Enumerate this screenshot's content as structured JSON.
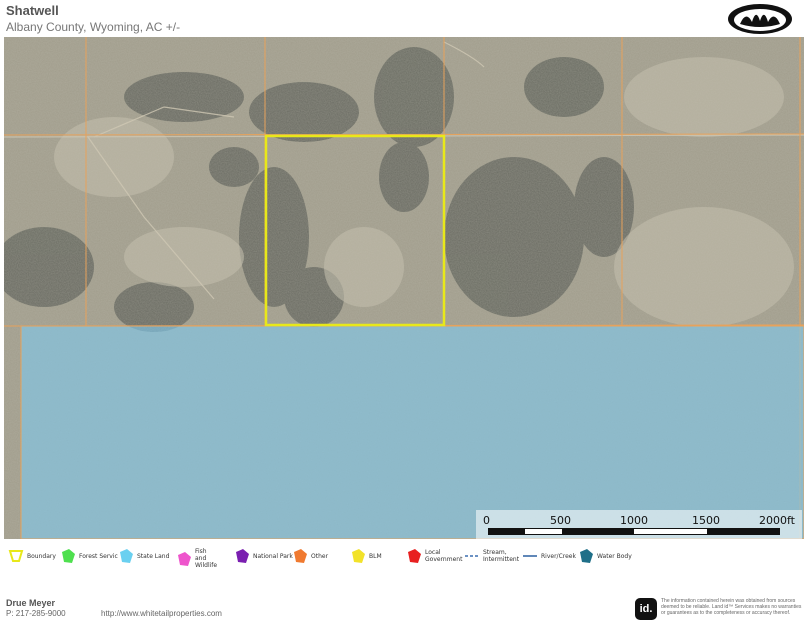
{
  "header": {
    "title": "Shatwell",
    "subtitle": "Albany County, Wyoming,  AC +/-"
  },
  "map": {
    "colors": {
      "parcel_boundary": "#e8e81a",
      "state_land": "#7fc8ec",
      "section_lines": "#e7a25b"
    },
    "scale_bar": {
      "labels": [
        "0",
        "500",
        "1000",
        "1500",
        "2000ft"
      ]
    }
  },
  "legend": {
    "items": [
      {
        "label": "Boundary",
        "color": "#e8e81a",
        "icon": "boundary-icon"
      },
      {
        "label": "Forest Servic",
        "color": "#4fe04f",
        "icon": "forest-service-icon"
      },
      {
        "label": "State Land",
        "color": "#6ad0f0",
        "icon": "state-land-icon"
      },
      {
        "label": "Fish and Wildlife",
        "color": "#ee55cc",
        "icon": "fish-wildlife-icon"
      },
      {
        "label": "National Park",
        "color": "#7a1fb0",
        "icon": "national-park-icon"
      },
      {
        "label": "Other",
        "color": "#f07a30",
        "icon": "other-icon"
      },
      {
        "label": "BLM",
        "color": "#f2e22a",
        "icon": "blm-icon"
      },
      {
        "label": "Local Government",
        "color": "#e82020",
        "icon": "local-government-icon"
      },
      {
        "label": "Stream, Intermittent",
        "color": "#3b6fb0",
        "icon": "stream-icon"
      },
      {
        "label": "River/Creek",
        "color": "#2b5fa0",
        "icon": "river-icon"
      },
      {
        "label": "Water Body",
        "color": "#1f6f88",
        "icon": "water-body-icon"
      }
    ]
  },
  "footer": {
    "agent_name": "Drue Meyer",
    "agent_phone": "P: 217-285-9000",
    "website": "http://www.whitetailproperties.com",
    "id_logo": "id.",
    "disclaimer": "The information contained herein was obtained from sources deemed to be reliable. Land id™ Services makes no warranties or guarantees as to the completeness or accuracy thereof."
  }
}
